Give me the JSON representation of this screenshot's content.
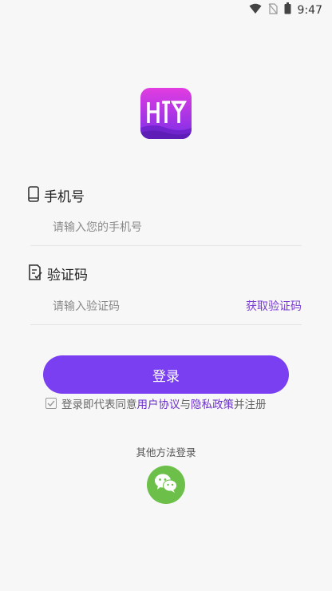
{
  "status_bar": {
    "time": "9:47",
    "icons": [
      "wifi-icon",
      "no-sim-icon",
      "battery-icon"
    ]
  },
  "app": {
    "logo_icon": "app-logo",
    "brand_color": "#7a3ff0"
  },
  "phone": {
    "label": "手机号",
    "icon": "phone-icon",
    "placeholder": "请输入您的手机号",
    "value": ""
  },
  "code": {
    "label": "验证码",
    "icon": "document-check-icon",
    "placeholder": "请输入验证码",
    "value": "",
    "get_code_label": "获取验证码"
  },
  "login_button": {
    "label": "登录"
  },
  "agreement": {
    "checked": true,
    "prefix": "登录即代表同意",
    "user_agreement": "用户协议",
    "conjunction": "与",
    "privacy_policy": "隐私政策",
    "suffix": "并注册"
  },
  "other_login": {
    "title": "其他方法登录",
    "wechat_icon": "wechat-icon",
    "wechat_color": "#6cc04a"
  }
}
